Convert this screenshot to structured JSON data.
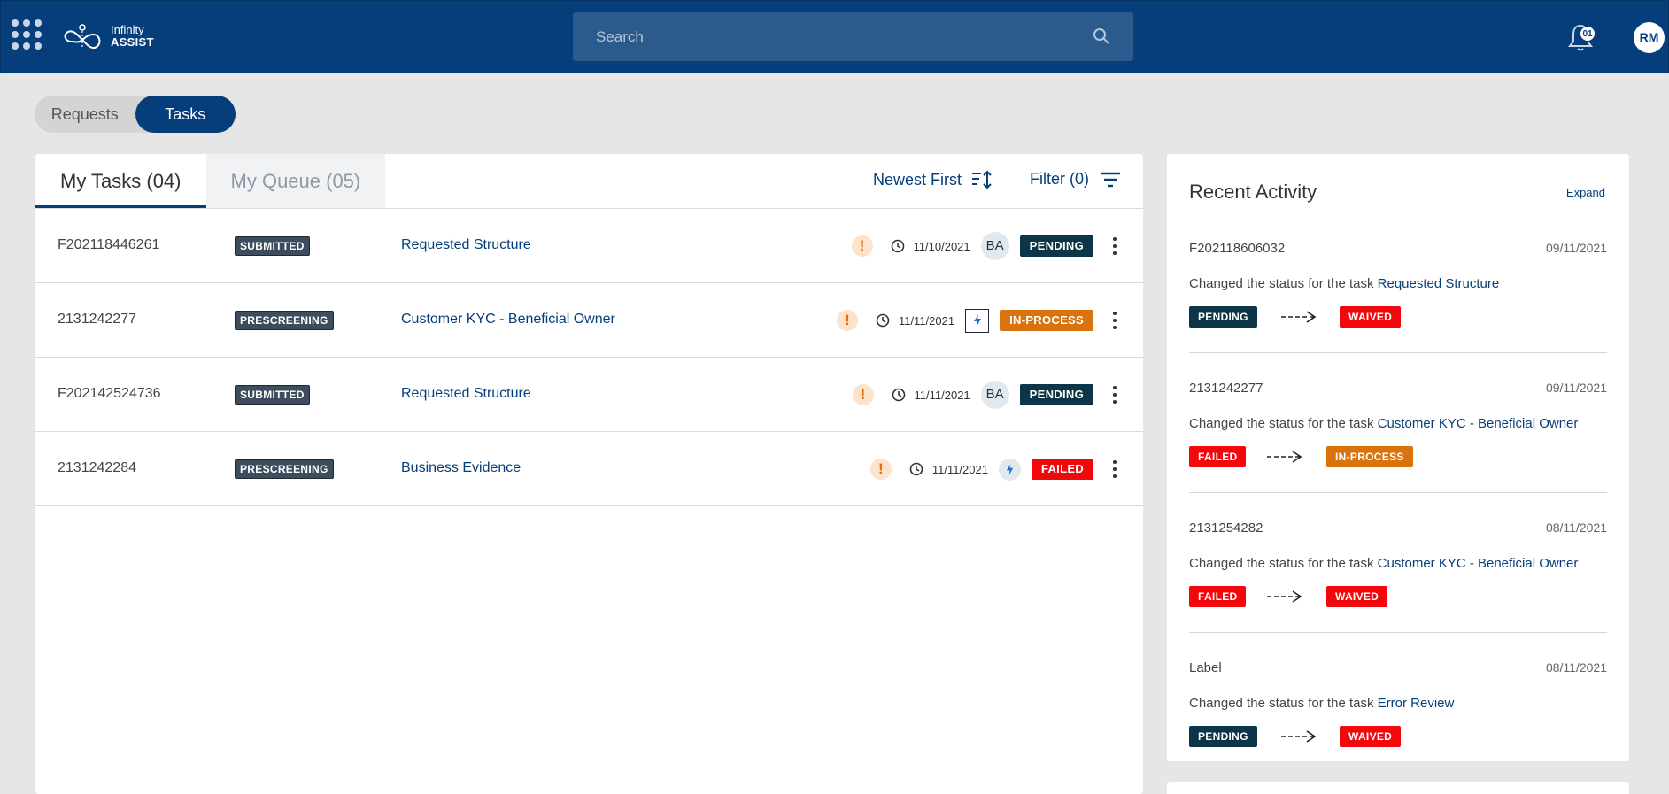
{
  "header": {
    "logo_line1": "Infinity",
    "logo_line2": "ASSIST",
    "search_placeholder": "Search",
    "notifications_count": "01",
    "user_initials": "RM"
  },
  "toggle": {
    "requests_label": "Requests",
    "tasks_label": "Tasks",
    "active": "Tasks"
  },
  "tasks": {
    "tabs": [
      {
        "label": "My Tasks (04)",
        "active": true
      },
      {
        "label": "My Queue (05)",
        "active": false
      }
    ],
    "sort_label": "Newest First",
    "filter_label": "Filter (0)",
    "rows": [
      {
        "id": "F202118446261",
        "stage": "SUBMITTED",
        "name": "Requested Structure",
        "date": "11/10/2021",
        "owner": "BA",
        "status": "PENDING",
        "status_color": "#0c3547"
      },
      {
        "id": "2131242277",
        "stage": "PRESCREENING",
        "name": "Customer KYC - Beneficial Owner",
        "date": "11/11/2021",
        "owner": "",
        "status": "IN-PROCESS",
        "status_color": "#d9730d"
      },
      {
        "id": "F202142524736",
        "stage": "SUBMITTED",
        "name": "Requested Structure",
        "date": "11/11/2021",
        "owner": "BA",
        "status": "PENDING",
        "status_color": "#0c3547"
      },
      {
        "id": "2131242284",
        "stage": "PRESCREENING",
        "name": "Business Evidence",
        "date": "11/11/2021",
        "owner": "",
        "status": "FAILED",
        "status_color": "#f2070d"
      }
    ]
  },
  "activity": {
    "title": "Recent Activity",
    "expand_label": "Expand",
    "desc_prefix": "Changed the status for the task",
    "items": [
      {
        "id": "F202118606032",
        "date": "09/11/2021",
        "task": "Requested Structure",
        "from": "PENDING",
        "from_color": "#0c3547",
        "to": "WAIVED",
        "to_color": "#f2070d"
      },
      {
        "id": "2131242277",
        "date": "09/11/2021",
        "task": "Customer KYC - Beneficial Owner",
        "from": "FAILED",
        "from_color": "#f2070d",
        "to": "IN-PROCESS",
        "to_color": "#d9730d"
      },
      {
        "id": "2131254282",
        "date": "08/11/2021",
        "task": "Customer KYC - Beneficial Owner",
        "from": "FAILED",
        "from_color": "#f2070d",
        "to": "WAIVED",
        "to_color": "#f2070d"
      },
      {
        "id": "Label",
        "date": "08/11/2021",
        "task": "Error Review",
        "from": "PENDING",
        "from_color": "#0c3547",
        "to": "WAIVED",
        "to_color": "#f2070d"
      }
    ]
  },
  "colors": {
    "brand": "#063e7b",
    "warning": "#e26d0a"
  }
}
